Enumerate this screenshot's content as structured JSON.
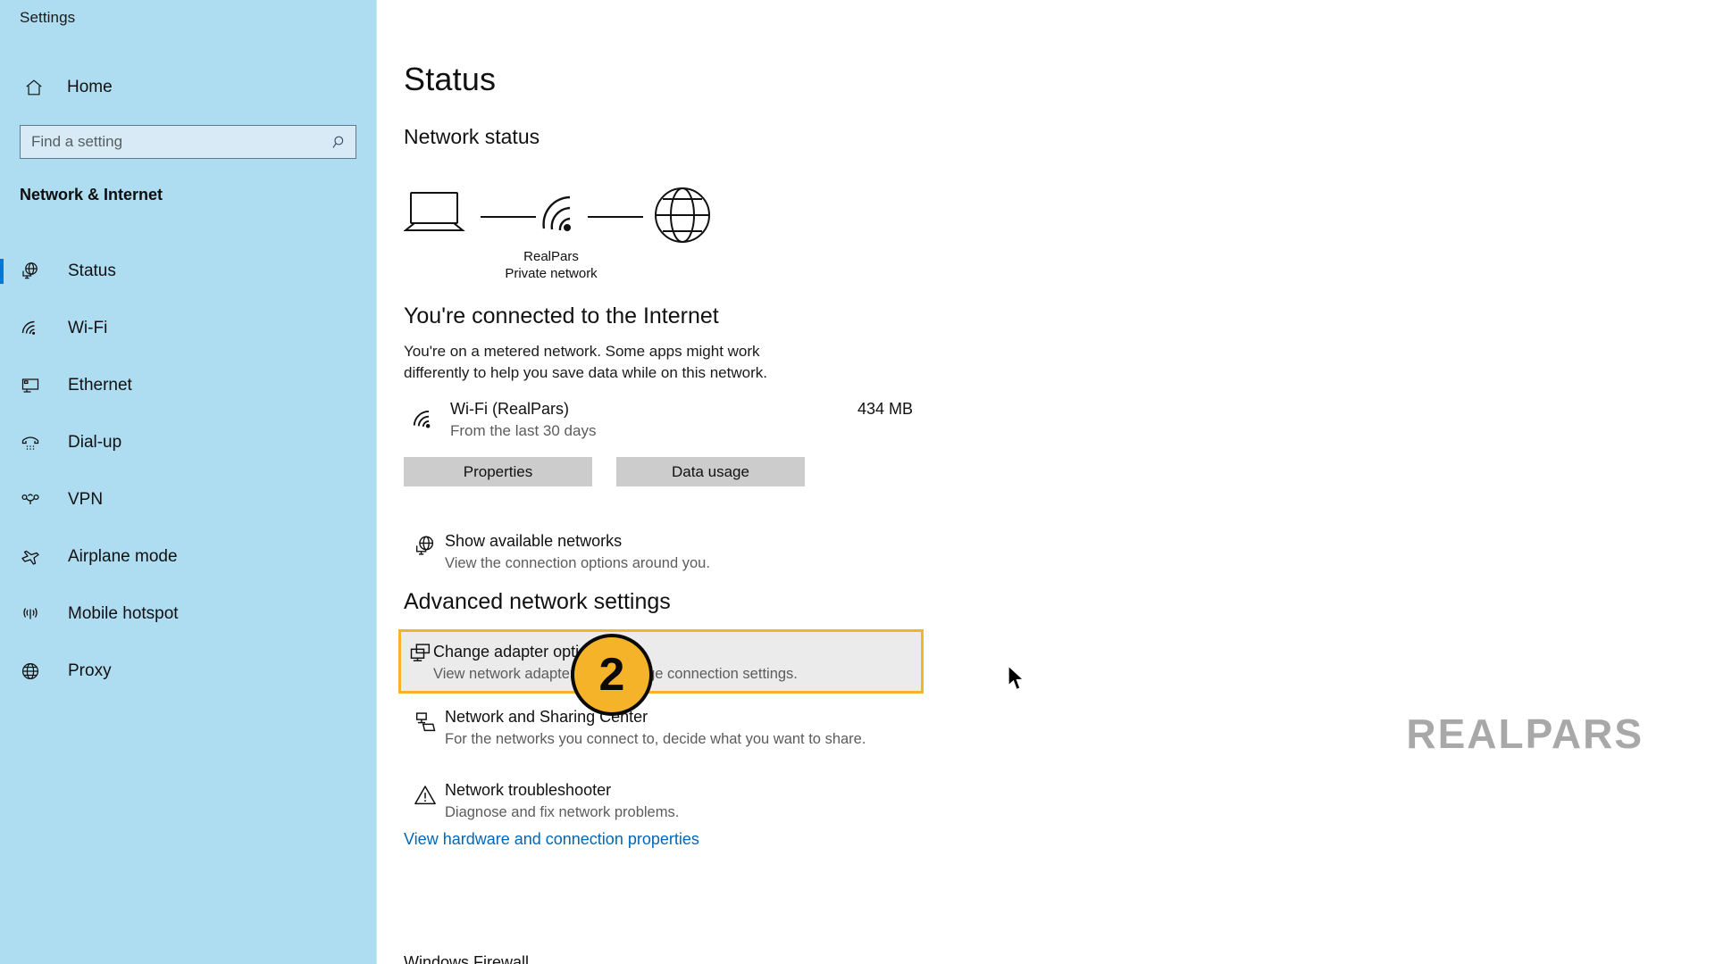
{
  "sidebar": {
    "app_title": "Settings",
    "home_label": "Home",
    "search": {
      "placeholder": "Find a setting",
      "value": ""
    },
    "category_heading": "Network & Internet",
    "items": [
      {
        "label": "Status",
        "icon": "globe-monitor-icon",
        "active": true
      },
      {
        "label": "Wi-Fi",
        "icon": "wifi-icon",
        "active": false
      },
      {
        "label": "Ethernet",
        "icon": "ethernet-icon",
        "active": false
      },
      {
        "label": "Dial-up",
        "icon": "dialup-phone-icon",
        "active": false
      },
      {
        "label": "VPN",
        "icon": "vpn-icon",
        "active": false
      },
      {
        "label": "Airplane mode",
        "icon": "airplane-icon",
        "active": false
      },
      {
        "label": "Mobile hotspot",
        "icon": "hotspot-icon",
        "active": false
      },
      {
        "label": "Proxy",
        "icon": "globe-icon",
        "active": false
      }
    ]
  },
  "main": {
    "page_title": "Status",
    "network_status_heading": "Network status",
    "diagram": {
      "device_icon": "laptop-icon",
      "connection_icon": "wifi-icon",
      "internet_icon": "globe-icon",
      "network_name": "RealPars",
      "network_type": "Private network"
    },
    "connected_title": "You're connected to the Internet",
    "metered_text": "You're on a metered network. Some apps might work differently to help you save data while on this network.",
    "wifi_row": {
      "name": "Wi-Fi (RealPars)",
      "subtitle": "From the last 30 days",
      "usage": "434 MB",
      "icon": "wifi-icon"
    },
    "buttons": {
      "properties": "Properties",
      "data_usage": "Data usage"
    },
    "show_networks": {
      "title": "Show available networks",
      "subtitle": "View the connection options around you.",
      "icon": "globe-monitor-icon"
    },
    "advanced_heading": "Advanced network settings",
    "advanced_items": [
      {
        "title": "Change adapter options",
        "subtitle": "View network adapters and change connection settings.",
        "icon": "adapter-monitor-icon",
        "highlighted": true
      },
      {
        "title": "Network and Sharing Center",
        "subtitle": "For the networks you connect to, decide what you want to share.",
        "icon": "sharing-center-icon",
        "highlighted": false
      },
      {
        "title": "Network troubleshooter",
        "subtitle": "Diagnose and fix network problems.",
        "icon": "warning-triangle-icon",
        "highlighted": false
      }
    ],
    "view_hardware_link": "View hardware and connection properties",
    "cut_off_text": "Windows Firewall"
  },
  "annotations": {
    "step_badge": "2",
    "badge_color": "#f5b32a",
    "highlight_border_color": "#f5b32a"
  },
  "watermark": {
    "text": "REALPARS"
  }
}
